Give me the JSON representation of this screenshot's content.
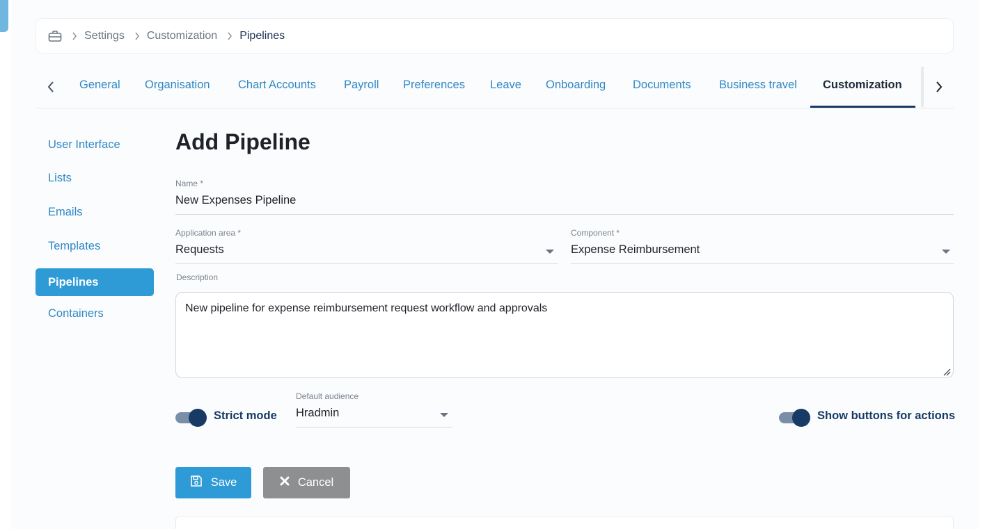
{
  "breadcrumb": {
    "items": [
      "Settings",
      "Customization",
      "Pipelines"
    ]
  },
  "tabs": {
    "items": [
      "General",
      "Organisation",
      "Chart Accounts",
      "Payroll",
      "Preferences",
      "Leave",
      "Onboarding",
      "Documents",
      "Business travel",
      "Customization"
    ],
    "active": "Customization"
  },
  "sidenav": {
    "items": [
      "User Interface",
      "Lists",
      "Emails",
      "Templates",
      "Pipelines",
      "Containers"
    ],
    "active": "Pipelines"
  },
  "form": {
    "title": "Add Pipeline",
    "name_label": "Name *",
    "name_value": "New Expenses Pipeline",
    "app_area_label": "Application area *",
    "app_area_value": "Requests",
    "component_label": "Component *",
    "component_value": "Expense Reimbursement",
    "description_label": "Description",
    "description_value": "New pipeline for expense reimbursement request workflow and approvals",
    "strict_mode_label": "Strict mode",
    "strict_mode_on": true,
    "audience_label": "Default audience",
    "audience_value": "Hradmin",
    "show_buttons_label": "Show buttons for actions",
    "show_buttons_on": true,
    "save_label": "Save",
    "cancel_label": "Cancel"
  },
  "colors": {
    "accent": "#2e9ad6",
    "link": "#2f88c4",
    "navy": "#173b64",
    "cancel": "#8d8f91"
  }
}
